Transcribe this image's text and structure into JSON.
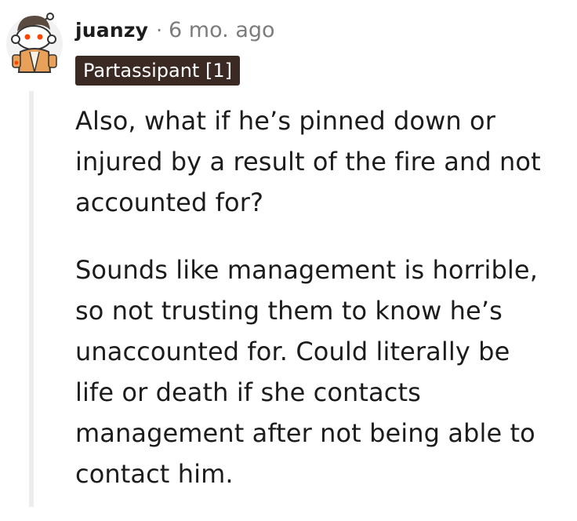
{
  "comment": {
    "author": "juanzy",
    "separator": "·",
    "time_ago": "6 mo. ago",
    "flair": "Partassipant [1]",
    "avatar_icon": "reddit-snoo-avatar-icon",
    "paragraphs": [
      {
        "lines": [
          "Also, what if he’s pinned down or",
          "injured by a result of the fire and not",
          "accounted for?"
        ]
      },
      {
        "lines": [
          "Sounds like management is horrible,",
          "so not trusting them to know he’s",
          "unaccounted for. Could literally be",
          "life or death if she contacts",
          "management after not being able to",
          "contact him."
        ]
      }
    ]
  },
  "colors": {
    "flair_bg": "#3b2a24",
    "meta_text": "#7c7c7c",
    "body_text": "#1c1c1c",
    "thread_line": "#ededed",
    "avatar_accent": "#ff4500"
  }
}
